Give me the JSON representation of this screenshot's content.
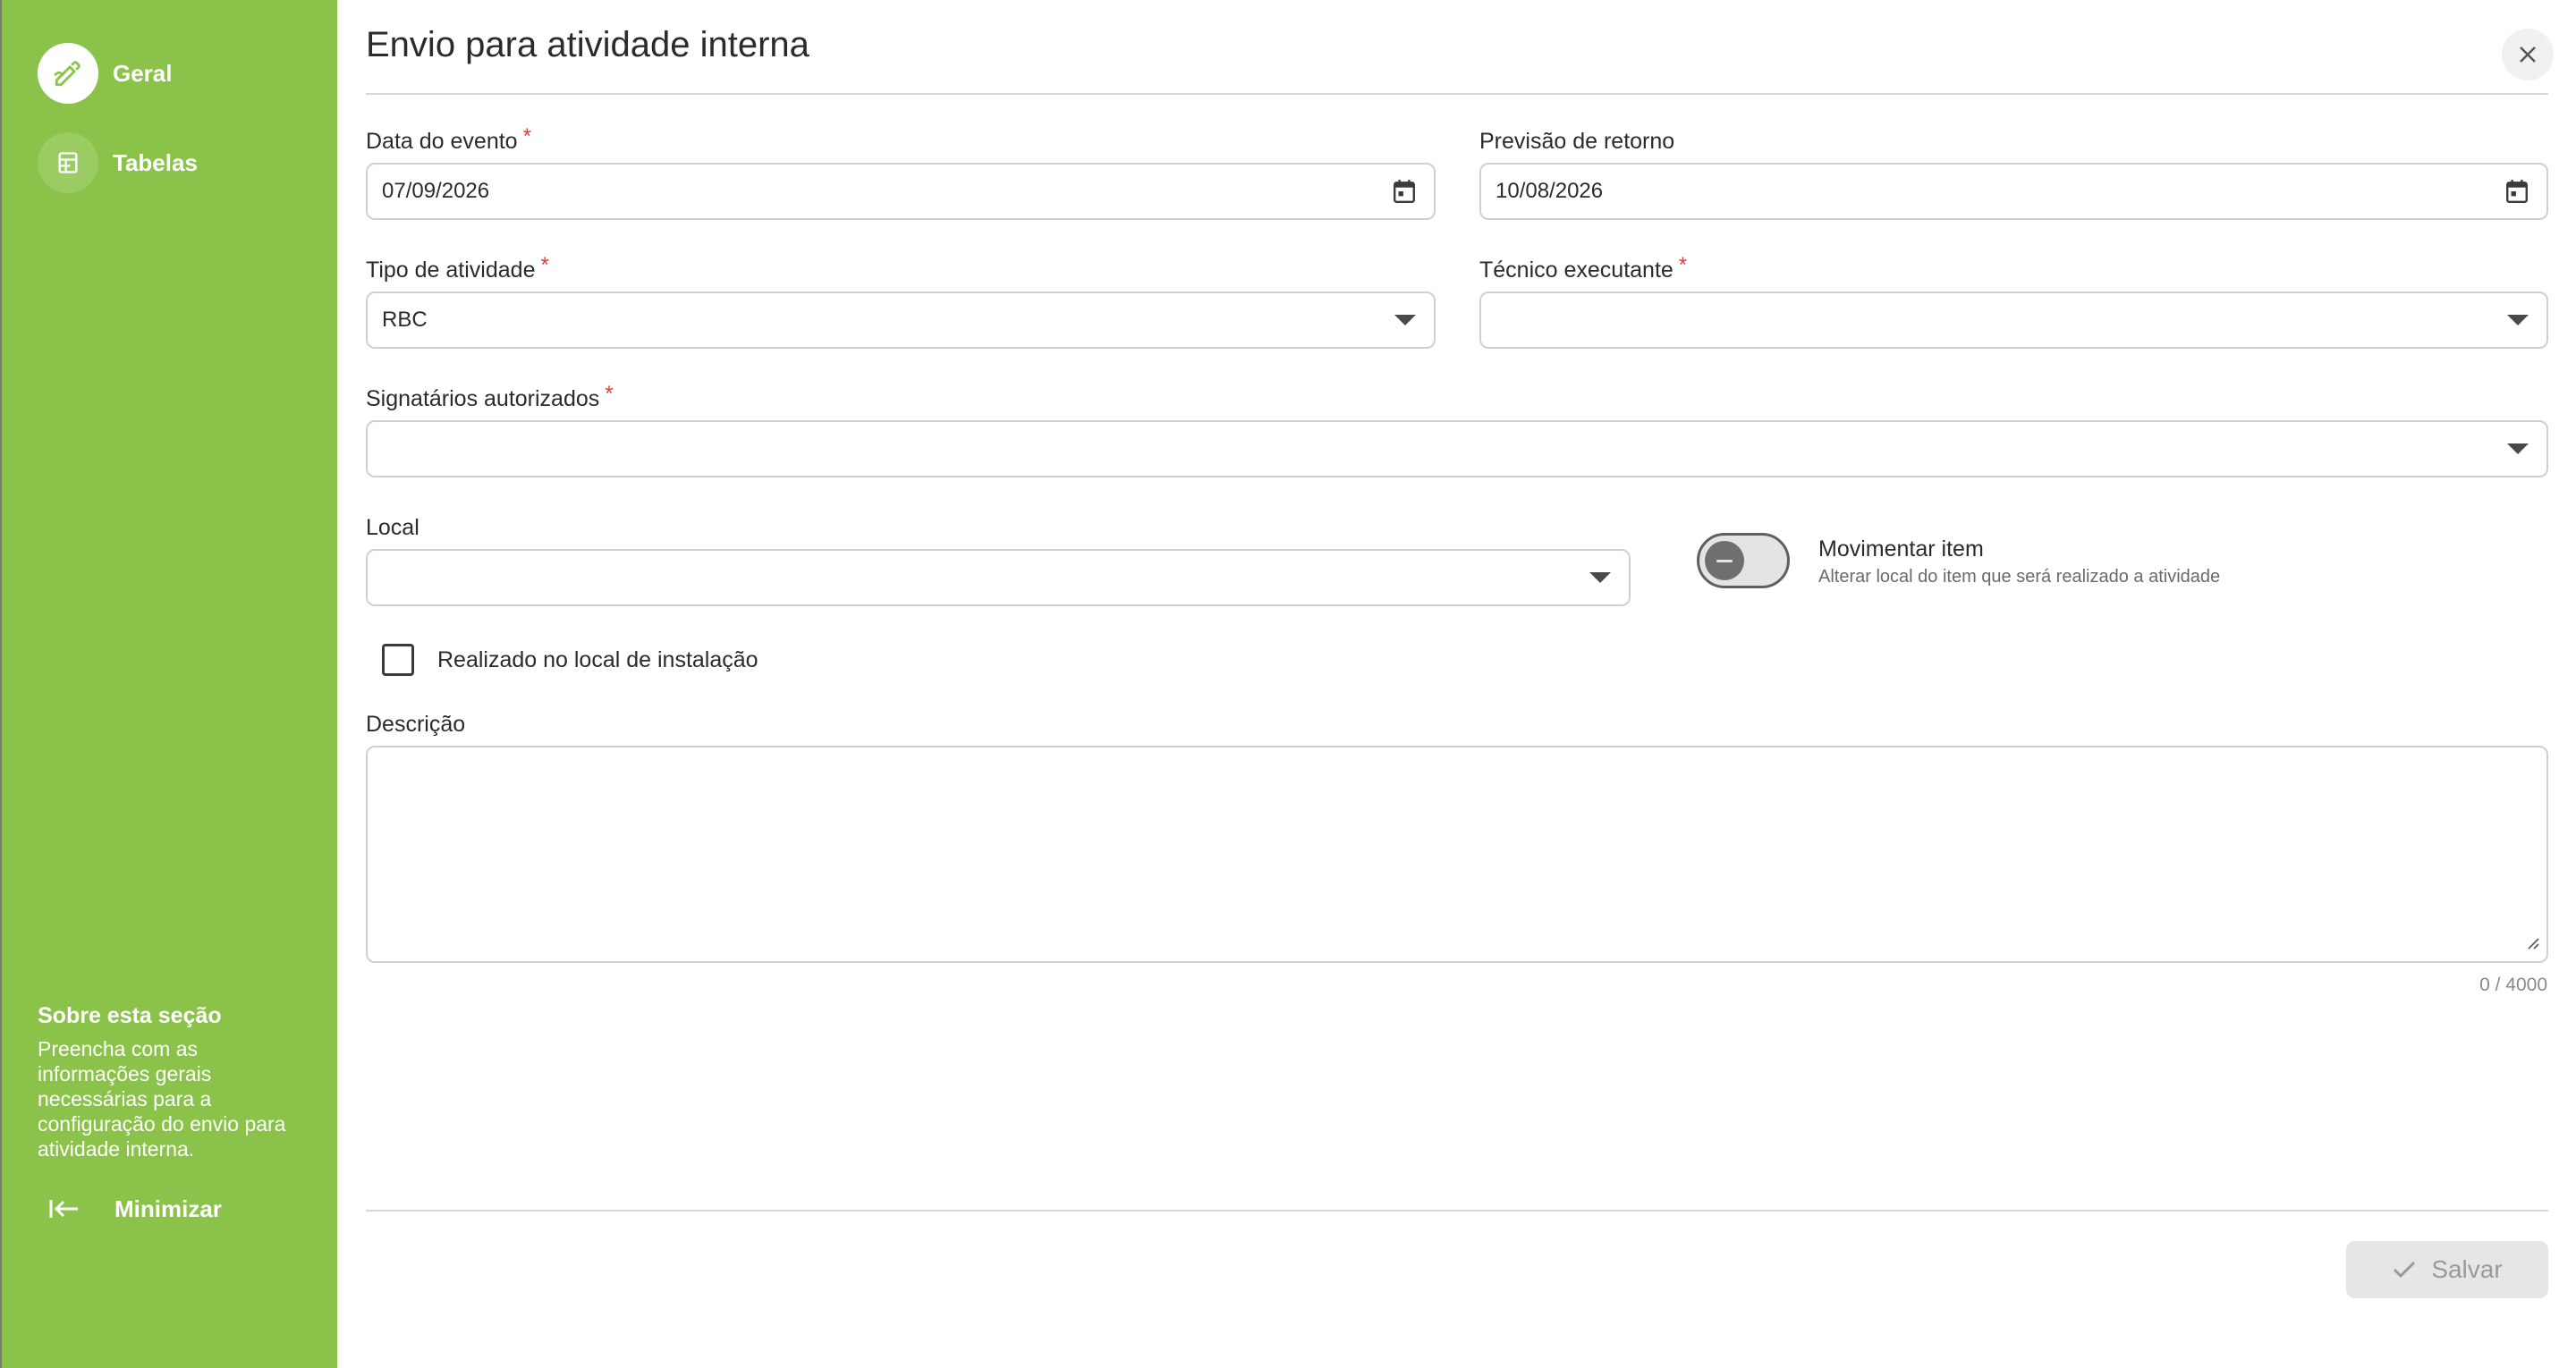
{
  "sidebar": {
    "items": [
      {
        "label": "Geral",
        "icon": "edit-icon",
        "active": true
      },
      {
        "label": "Tabelas",
        "icon": "table-icon",
        "active": false
      }
    ],
    "about": {
      "title": "Sobre esta seção",
      "text": "Preencha com as informações gerais necessárias para a configuração do envio para atividade interna."
    },
    "minimize_label": "Minimizar",
    "background_color": "#8bc34a"
  },
  "dialog": {
    "title": "Envio para atividade interna",
    "close_icon": "close-icon"
  },
  "form": {
    "data_evento": {
      "label": "Data do evento",
      "required": "*",
      "value": "07/09/2026",
      "icon": "calendar-icon"
    },
    "previsao_retorno": {
      "label": "Previsão de retorno",
      "value": "10/08/2026",
      "icon": "calendar-icon"
    },
    "tipo_atividade": {
      "label": "Tipo de atividade",
      "required": "*",
      "value": "RBC"
    },
    "tecnico_executante": {
      "label": "Técnico executante",
      "required": "*",
      "value": ""
    },
    "signatarios": {
      "label": "Signatários autorizados",
      "required": "*",
      "value": ""
    },
    "local": {
      "label": "Local",
      "value": ""
    },
    "movimentar": {
      "title": "Movimentar item",
      "subtitle": "Alterar local do item que será realizado a atividade",
      "checked": false
    },
    "realizado_local": {
      "label": "Realizado no local de instalação",
      "checked": false
    },
    "descricao": {
      "label": "Descrição",
      "value": "",
      "counter": "0 / 4000"
    }
  },
  "footer": {
    "save_label": "Salvar",
    "save_icon": "check-icon",
    "disabled": true
  }
}
